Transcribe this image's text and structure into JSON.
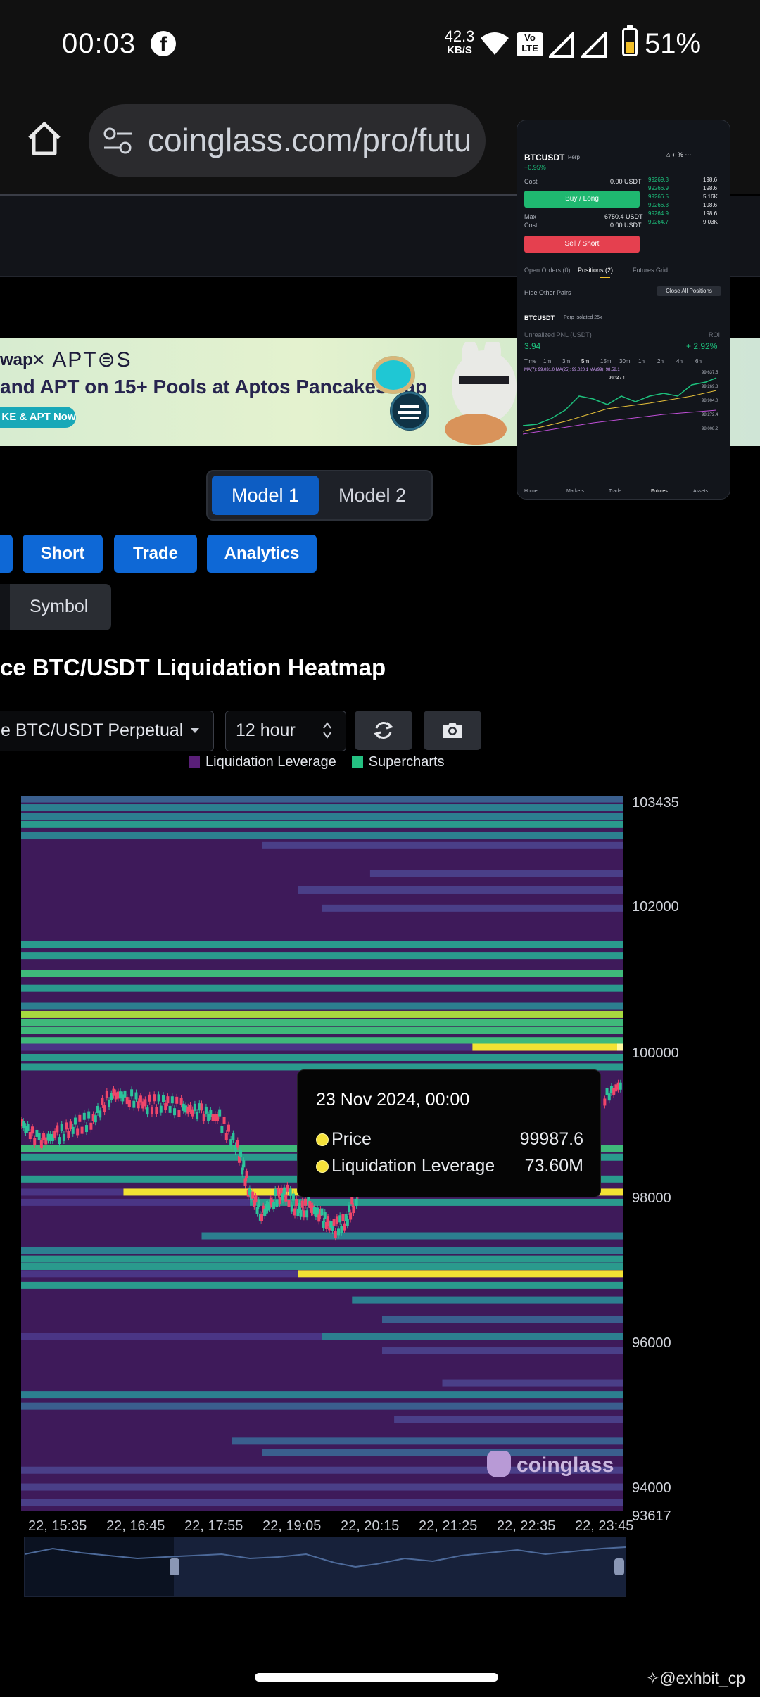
{
  "status_bar": {
    "time": "00:03",
    "net_speed_value": "42.3",
    "net_speed_unit": "KB/S",
    "volte": "Vo LTE",
    "volte_sim": "2",
    "battery_percent": "51%",
    "battery_level": 0.51
  },
  "browser": {
    "url": "coinglass.com/pro/futu"
  },
  "banner": {
    "brand_fragment": "wap",
    "partner": "× APT⊜S",
    "headline": "and APT on 15+ Pools at Aptos PancakeSwap",
    "cta": "KE & APT Now"
  },
  "model_tabs": {
    "model1": "Model 1",
    "model2": "Model 2",
    "active": "Model 1"
  },
  "nav_buttons": {
    "short": "Short",
    "trade": "Trade",
    "analytics": "Analytics"
  },
  "symbol_toggle": {
    "label": "Symbol"
  },
  "heatmap_title": "ce BTC/USDT Liquidation Heatmap",
  "controls": {
    "pair": "e BTC/USDT Perpetual",
    "interval": "12 hour"
  },
  "legend": {
    "items": [
      {
        "label": "Liquidation Leverage",
        "color": "#5a1f78"
      },
      {
        "label": "Supercharts",
        "color": "#24c081"
      }
    ]
  },
  "tooltip": {
    "date": "23 Nov 2024, 00:00",
    "price_label": "Price",
    "price_value": "99987.6",
    "leverage_label": "Liquidation Leverage",
    "leverage_value": "73.60M"
  },
  "watermark": "coinglass",
  "credit": "@exhbit_cp",
  "chart_data": {
    "type": "heatmap",
    "ylim": [
      93617,
      103435
    ],
    "yticks": [
      "103435",
      "102000",
      "100000",
      "98000",
      "96000",
      "94000",
      "93617"
    ],
    "xticks": [
      "22, 15:35",
      "22, 16:45",
      "22, 17:55",
      "22, 19:05",
      "22, 20:15",
      "22, 21:25",
      "22, 22:35",
      "22, 23:45"
    ],
    "bands": [
      {
        "price": 103400,
        "start": 0.0,
        "intensity": 0.35
      },
      {
        "price": 103280,
        "start": 0.0,
        "intensity": 0.45
      },
      {
        "price": 103160,
        "start": 0.0,
        "intensity": 0.4
      },
      {
        "price": 103050,
        "start": 0.0,
        "intensity": 0.55
      },
      {
        "price": 102900,
        "start": 0.0,
        "intensity": 0.42
      },
      {
        "price": 102760,
        "start": 0.4,
        "intensity": 0.3
      },
      {
        "price": 102380,
        "start": 0.58,
        "intensity": 0.28
      },
      {
        "price": 102150,
        "start": 0.46,
        "intensity": 0.3
      },
      {
        "price": 101900,
        "start": 0.5,
        "intensity": 0.28
      },
      {
        "price": 101400,
        "start": 0.0,
        "intensity": 0.62
      },
      {
        "price": 101250,
        "start": 0.0,
        "intensity": 0.5
      },
      {
        "price": 101000,
        "start": 0.0,
        "intensity": 0.7
      },
      {
        "price": 100800,
        "start": 0.0,
        "intensity": 0.5
      },
      {
        "price": 100560,
        "start": 0.0,
        "intensity": 0.4
      },
      {
        "price": 100440,
        "start": 0.0,
        "intensity": 0.9
      },
      {
        "price": 100330,
        "start": 0.0,
        "intensity": 0.7
      },
      {
        "price": 100220,
        "start": 0.0,
        "intensity": 0.65
      },
      {
        "price": 100080,
        "start": 0.0,
        "intensity": 0.8
      },
      {
        "price": 99990,
        "start": 0.75,
        "intensity": 1.0
      },
      {
        "price": 99850,
        "start": 0.0,
        "intensity": 0.55
      },
      {
        "price": 99720,
        "start": 0.0,
        "intensity": 0.5
      },
      {
        "price": 98600,
        "start": 0.0,
        "intensity": 0.7
      },
      {
        "price": 98480,
        "start": 0.0,
        "intensity": 0.55
      },
      {
        "price": 98180,
        "start": 0.0,
        "intensity": 0.6
      },
      {
        "price": 98000,
        "start": 0.17,
        "intensity": 0.95
      },
      {
        "price": 97860,
        "start": 0.38,
        "intensity": 0.5
      },
      {
        "price": 97400,
        "start": 0.3,
        "intensity": 0.4
      },
      {
        "price": 97200,
        "start": 0.0,
        "intensity": 0.48
      },
      {
        "price": 97080,
        "start": 0.0,
        "intensity": 0.55
      },
      {
        "price": 96980,
        "start": 0.0,
        "intensity": 0.58
      },
      {
        "price": 96880,
        "start": 0.46,
        "intensity": 1.0
      },
      {
        "price": 96720,
        "start": 0.0,
        "intensity": 0.5
      },
      {
        "price": 96520,
        "start": 0.55,
        "intensity": 0.4
      },
      {
        "price": 96250,
        "start": 0.6,
        "intensity": 0.35
      },
      {
        "price": 96020,
        "start": 0.5,
        "intensity": 0.42
      },
      {
        "price": 95820,
        "start": 0.6,
        "intensity": 0.3
      },
      {
        "price": 95380,
        "start": 0.7,
        "intensity": 0.3
      },
      {
        "price": 95220,
        "start": 0.0,
        "intensity": 0.4
      },
      {
        "price": 95060,
        "start": 0.0,
        "intensity": 0.38
      },
      {
        "price": 94880,
        "start": 0.62,
        "intensity": 0.3
      },
      {
        "price": 94580,
        "start": 0.35,
        "intensity": 0.34
      },
      {
        "price": 94420,
        "start": 0.4,
        "intensity": 0.34
      },
      {
        "price": 94180,
        "start": 0.0,
        "intensity": 0.3
      },
      {
        "price": 93950,
        "start": 0.0,
        "intensity": 0.25
      },
      {
        "price": 93740,
        "start": 0.0,
        "intensity": 0.22
      }
    ],
    "price_series": [
      {
        "t": 0.0,
        "p": 98950
      },
      {
        "t": 0.03,
        "p": 98700
      },
      {
        "t": 0.06,
        "p": 98780
      },
      {
        "t": 0.09,
        "p": 98900
      },
      {
        "t": 0.12,
        "p": 99000
      },
      {
        "t": 0.15,
        "p": 99350
      },
      {
        "t": 0.18,
        "p": 99300
      },
      {
        "t": 0.21,
        "p": 99200
      },
      {
        "t": 0.24,
        "p": 99220
      },
      {
        "t": 0.27,
        "p": 99150
      },
      {
        "t": 0.3,
        "p": 99100
      },
      {
        "t": 0.33,
        "p": 99000
      },
      {
        "t": 0.36,
        "p": 98600
      },
      {
        "t": 0.38,
        "p": 98000
      },
      {
        "t": 0.4,
        "p": 97700
      },
      {
        "t": 0.42,
        "p": 97900
      },
      {
        "t": 0.44,
        "p": 98000
      },
      {
        "t": 0.46,
        "p": 97750
      },
      {
        "t": 0.48,
        "p": 97800
      },
      {
        "t": 0.5,
        "p": 97650
      },
      {
        "t": 0.52,
        "p": 97500
      },
      {
        "t": 0.54,
        "p": 97600
      },
      {
        "t": 0.56,
        "p": 98000
      },
      {
        "t": 0.97,
        "p": 99300
      },
      {
        "t": 1.0,
        "p": 99500
      }
    ]
  },
  "app_preview": {
    "symbol": "BTCUSDT",
    "symbol_tag": "Perp",
    "change": "+0.95%",
    "cost_label": "Cost",
    "cost_value": "0.00 USDT",
    "buy_label": "Buy / Long",
    "max_label": "Max",
    "max_value": "6750.4 USDT",
    "cost2_value": "0.00 USDT",
    "sell_label": "Sell / Short",
    "book": [
      {
        "price": "99269.3",
        "size": "198.6"
      },
      {
        "price": "99266.9",
        "size": "198.6"
      },
      {
        "price": "99266.5",
        "size": "5.16K"
      },
      {
        "price": "99266.3",
        "size": "198.6"
      },
      {
        "price": "99264.9",
        "size": "198.6"
      },
      {
        "price": "99264.7",
        "size": "9.03K"
      }
    ],
    "tabs": [
      "Open Orders (0)",
      "Positions (2)",
      "Futures Grid"
    ],
    "hide_pairs": "Hide Other Pairs",
    "close_all": "Close All Positions",
    "pos_symbol": "BTCUSDT",
    "pos_tags": "Perp  Isolated 25x",
    "pnl_label": "Unrealized PNL (USDT)",
    "roi_label": "ROI",
    "pnl_value": "3.94",
    "roi_value": "+ 2.92%",
    "timeframes": [
      "Time",
      "1m",
      "3m",
      "5m",
      "15m",
      "30m",
      "1h",
      "2h",
      "4h",
      "6h"
    ],
    "ma_line": "MA(7): 99,031.0   MA(25): 99,020.1   MA(99): 98,58.1",
    "last_price": "99,347.1",
    "ticks": [
      "99,637.5",
      "99,269.8",
      "98,904.0",
      "98,272.4",
      "98,008.2"
    ],
    "bottom_nav": [
      "Home",
      "Markets",
      "Trade",
      "Futures",
      "Assets"
    ]
  }
}
